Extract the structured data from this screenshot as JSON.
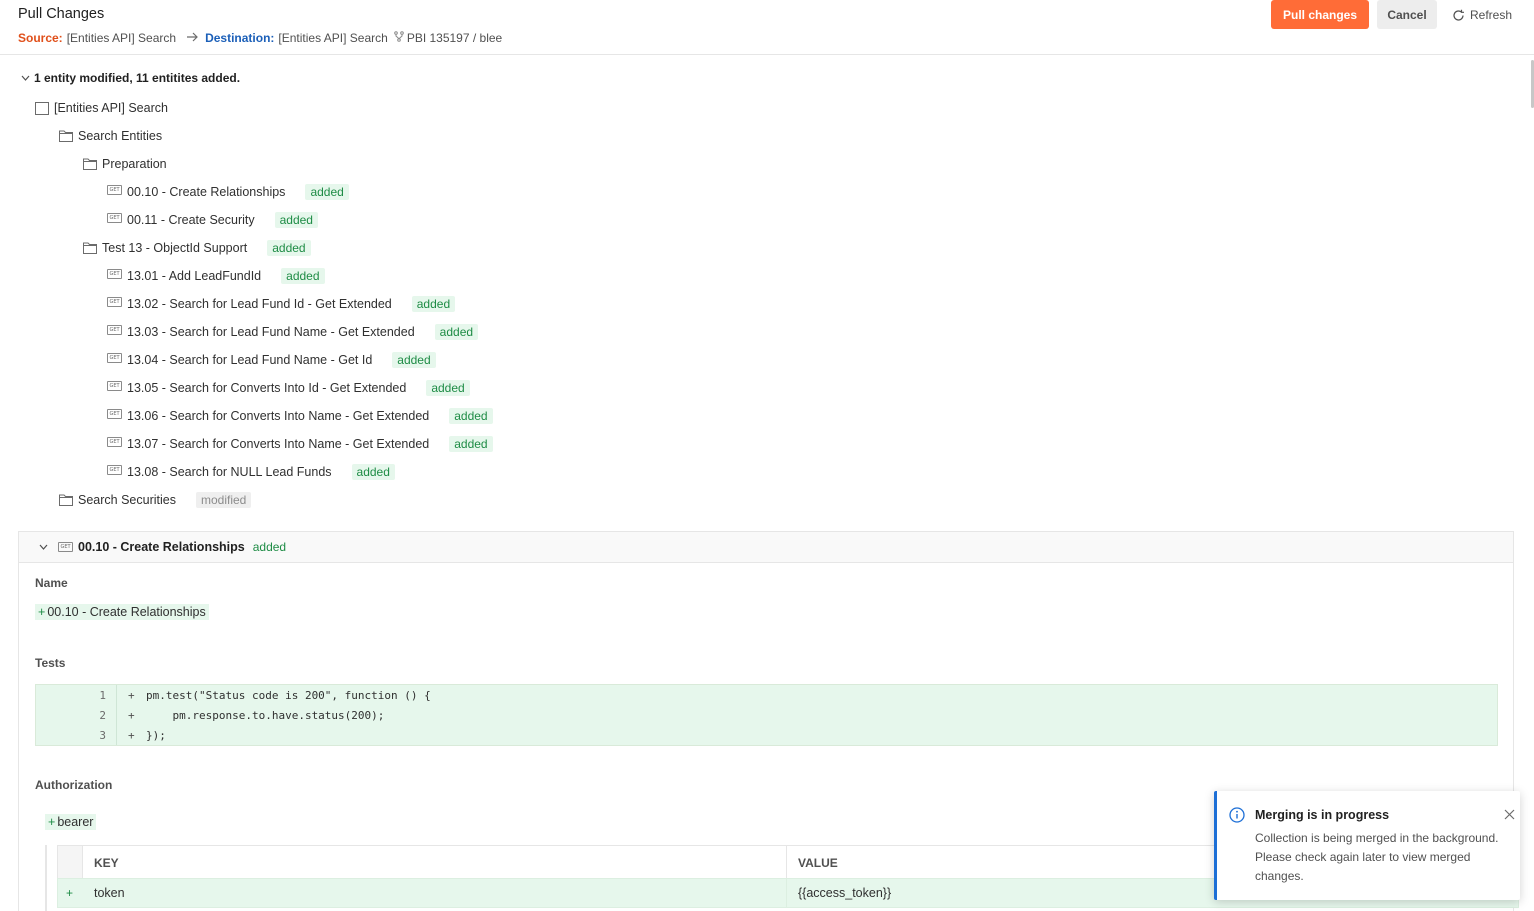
{
  "header": {
    "title": "Pull Changes",
    "source_label": "Source:",
    "source_value": "[Entities API] Search",
    "destination_label": "Destination:",
    "destination_value": "[Entities API] Search",
    "fork_ref": "PBI 135197 / blee",
    "pull_button": "Pull changes",
    "cancel_button": "Cancel",
    "refresh_button": "Refresh"
  },
  "summary": "1 entity modified, 11 entitites added.",
  "tree": {
    "collection": "[Entities API] Search",
    "folder_search_entities": "Search Entities",
    "folder_preparation": "Preparation",
    "items": [
      {
        "label": "00.10 - Create Relationships",
        "status": "added"
      },
      {
        "label": "00.11 - Create Security",
        "status": "added"
      },
      {
        "label": "Test 13 - ObjectId Support",
        "status": "added"
      },
      {
        "label": "13.01 - Add LeadFundId",
        "status": "added"
      },
      {
        "label": "13.02 - Search for Lead Fund Id - Get Extended",
        "status": "added"
      },
      {
        "label": "13.03 - Search for Lead Fund Name - Get Extended",
        "status": "added"
      },
      {
        "label": "13.04 - Search for Lead Fund Name - Get Id",
        "status": "added"
      },
      {
        "label": "13.05 - Search for Converts Into Id - Get Extended",
        "status": "added"
      },
      {
        "label": "13.06 - Search for Converts Into Name - Get Extended",
        "status": "added"
      },
      {
        "label": "13.07 - Search for Converts Into Name - Get Extended",
        "status": "added"
      },
      {
        "label": "13.08 - Search for NULL Lead Funds",
        "status": "added"
      }
    ],
    "folder_search_securities": "Search Securities",
    "folder_search_securities_status": "modified",
    "get_icon": "GET"
  },
  "detail": {
    "title": "00.10 - Create Relationships",
    "status": "added",
    "name_label": "Name",
    "name_plus": "+",
    "name_value": "00.10 - Create Relationships",
    "tests_label": "Tests",
    "code": [
      {
        "n": "1",
        "sign": "+",
        "text": "pm.test(\"Status code is 200\", function () {"
      },
      {
        "n": "2",
        "sign": "+",
        "text": "    pm.response.to.have.status(200);"
      },
      {
        "n": "3",
        "sign": "+",
        "text": "});"
      }
    ],
    "auth_label": "Authorization",
    "auth_plus": "+",
    "auth_type": "bearer",
    "table": {
      "key_header": "KEY",
      "value_header": "VALUE",
      "row_sign": "+",
      "row_key": "token",
      "row_value": "{{access_token}}"
    }
  },
  "toast": {
    "title": "Merging is in progress",
    "body": "Collection is being merged in the background. Please check again later to view merged changes."
  },
  "colors": {
    "accent": "#ff6c37",
    "source": "#e0501b",
    "destination": "#1b5fb8",
    "added_bg": "#e6f7ec",
    "added_text": "#1e8c45",
    "info": "#1d6fd6"
  }
}
